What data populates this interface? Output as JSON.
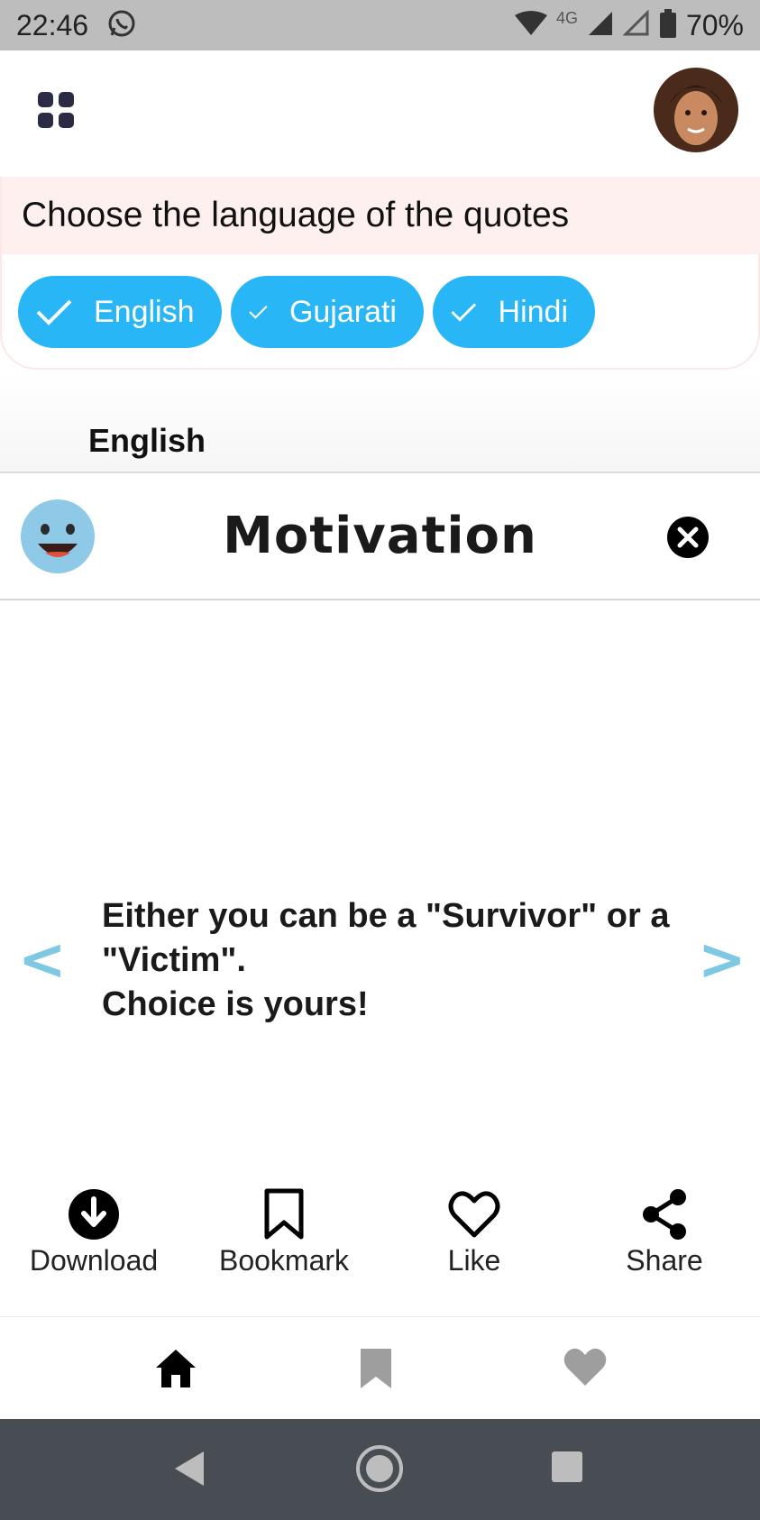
{
  "status_bar": {
    "time": "22:46",
    "network_label": "4G",
    "battery_percent": "70%",
    "icons": [
      "whatsapp-icon",
      "wifi-icon",
      "signal-icon",
      "signal-empty-icon",
      "battery-icon"
    ]
  },
  "app_bar": {
    "menu_icon": "grid-menu-icon",
    "avatar_icon": "user-avatar"
  },
  "language_panel": {
    "heading": "Choose the language of the quotes",
    "chips": [
      {
        "label": "English",
        "selected": true
      },
      {
        "label": "Gujarati",
        "selected": true
      },
      {
        "label": "Hindi",
        "selected": true
      }
    ],
    "accent_color": "#29b6f6"
  },
  "selected_language": "English",
  "category": {
    "title": "Motivation",
    "emoji_icon": "smiley-face-icon",
    "close_icon": "close-circle-icon"
  },
  "quote": {
    "prev_label": "<",
    "next_label": ">",
    "text": "Either you can be  a \"Survivor\" or a \"Victim\".\nChoice is yours!"
  },
  "actions": [
    {
      "label": "Download",
      "icon": "download-icon"
    },
    {
      "label": "Bookmark",
      "icon": "bookmark-icon"
    },
    {
      "label": "Like",
      "icon": "heart-outline-icon"
    },
    {
      "label": "Share",
      "icon": "share-icon"
    }
  ],
  "tabs": [
    {
      "icon": "home-icon",
      "active": true
    },
    {
      "icon": "bookmark-icon",
      "active": false
    },
    {
      "icon": "heart-icon",
      "active": false
    }
  ],
  "system_nav": [
    "back-icon",
    "home-circle-icon",
    "recents-icon"
  ]
}
